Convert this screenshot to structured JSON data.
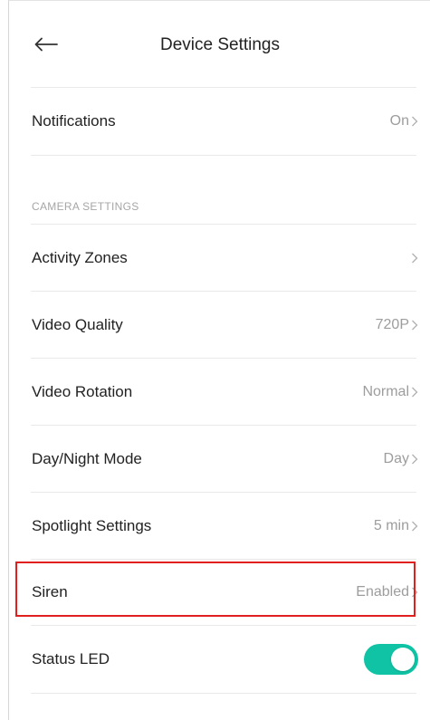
{
  "header": {
    "title": "Device Settings",
    "back_icon": "arrow-left-icon"
  },
  "rows": {
    "notifications": {
      "label": "Notifications",
      "value": "On"
    },
    "section_camera": "CAMERA SETTINGS",
    "activity_zones": {
      "label": "Activity Zones",
      "value": ""
    },
    "video_quality": {
      "label": "Video Quality",
      "value": "720P"
    },
    "video_rotation": {
      "label": "Video Rotation",
      "value": "Normal"
    },
    "day_night": {
      "label": "Day/Night Mode",
      "value": "Day"
    },
    "spotlight": {
      "label": "Spotlight Settings",
      "value": "5 min"
    },
    "siren": {
      "label": "Siren",
      "value": "Enabled"
    },
    "status_led": {
      "label": "Status LED",
      "toggle_on": true
    }
  },
  "colors": {
    "accent": "#10c3a5",
    "highlight": "#e0201f",
    "text": "#222222",
    "muted": "#9d9d9d",
    "divider": "#e9e9e9"
  }
}
